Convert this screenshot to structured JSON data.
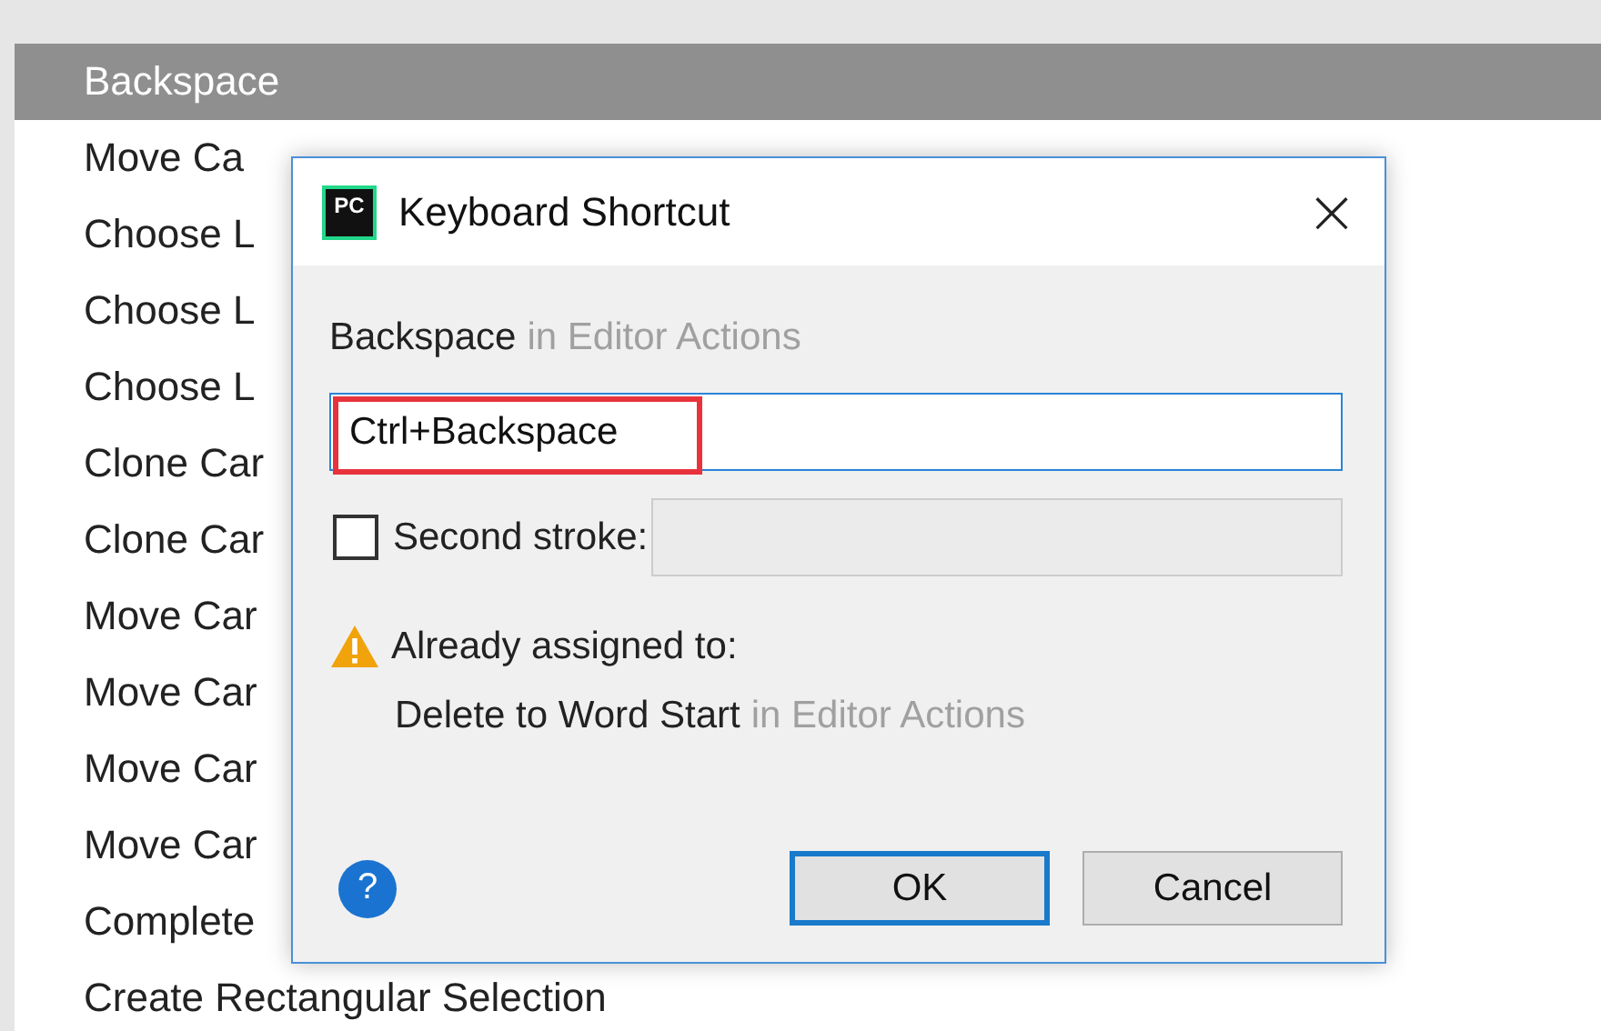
{
  "list": {
    "items": [
      {
        "label": "Backspace",
        "selected": true
      },
      {
        "label": "Move Ca",
        "selected": false
      },
      {
        "label": "Choose L",
        "selected": false
      },
      {
        "label": "Choose L",
        "selected": false
      },
      {
        "label": "Choose L",
        "selected": false
      },
      {
        "label": "Clone Car",
        "selected": false
      },
      {
        "label": "Clone Car",
        "selected": false
      },
      {
        "label": "Move Car",
        "selected": false
      },
      {
        "label": "Move Car",
        "selected": false
      },
      {
        "label": "Move Car",
        "selected": false
      },
      {
        "label": "Move Car",
        "selected": false
      },
      {
        "label": "Complete",
        "selected": false
      },
      {
        "label": "Create Rectangular Selection",
        "selected": false
      }
    ]
  },
  "dialog": {
    "title": "Keyboard Shortcut",
    "logo_text": "PC",
    "close_glyph": "×",
    "action": {
      "name": "Backspace",
      "context": "in Editor Actions"
    },
    "shortcut_field": {
      "value": "Ctrl+Backspace",
      "highlighted": true
    },
    "second_stroke": {
      "label": "Second stroke:",
      "checked": false
    },
    "warning": {
      "heading": "Already assigned to:",
      "action": "Delete to Word Start",
      "context": "in Editor Actions"
    },
    "help_glyph": "?",
    "buttons": [
      {
        "label": "OK",
        "default": true
      },
      {
        "label": "Cancel",
        "default": false
      }
    ]
  }
}
